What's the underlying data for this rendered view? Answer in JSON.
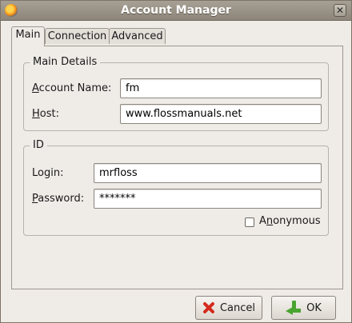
{
  "window": {
    "title": "Account Manager",
    "close_glyph": "✕"
  },
  "tabs": [
    {
      "label": "Main",
      "active": true
    },
    {
      "label": "Connection",
      "active": false
    },
    {
      "label": "Advanced",
      "active": false
    }
  ],
  "main_details": {
    "legend": "Main Details",
    "account_name": {
      "label_mnemonic": "A",
      "label_rest": "ccount Name:",
      "value": "fm"
    },
    "host": {
      "label_mnemonic": "H",
      "label_rest": "ost:",
      "value": "www.flossmanuals.net"
    }
  },
  "id_section": {
    "legend": "ID",
    "login": {
      "label": "Login:",
      "value": "mrfloss"
    },
    "password": {
      "label_mnemonic": "P",
      "label_rest": "assword:",
      "value": "*******"
    },
    "anonymous": {
      "label_before": "A",
      "label_mnemonic": "n",
      "label_rest": "onymous",
      "checked": false
    }
  },
  "buttons": {
    "cancel": {
      "label": "Cancel",
      "icon": "cancel-icon"
    },
    "ok": {
      "label": "OK",
      "icon": "ok-arrow-icon"
    }
  },
  "colors": {
    "cancel_icon": "#d42a1e",
    "ok_icon": "#4aa531",
    "titlebar": "#8d8579"
  }
}
